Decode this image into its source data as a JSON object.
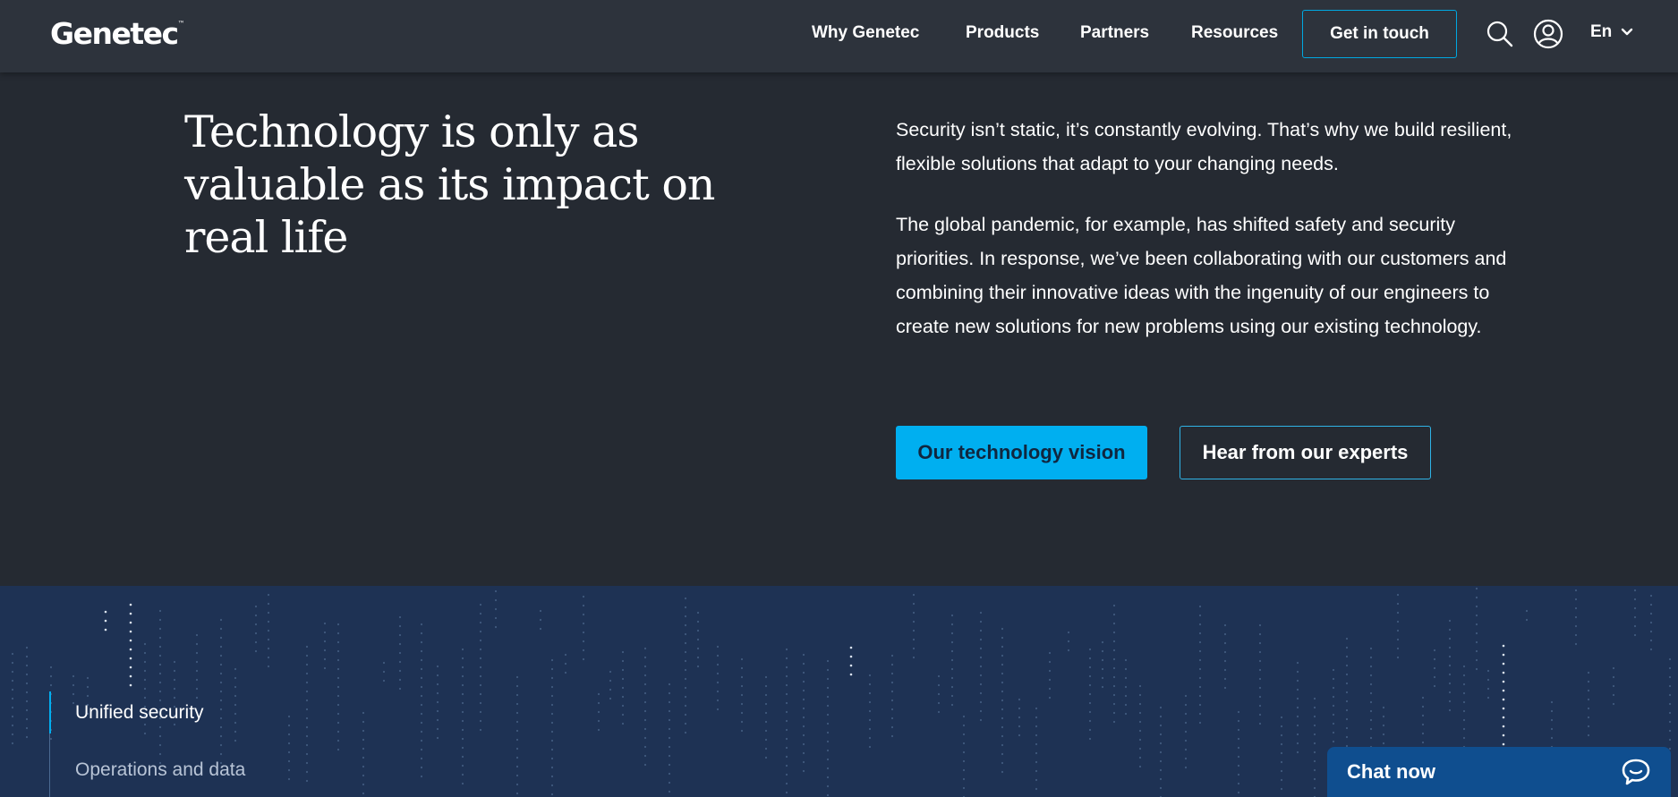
{
  "header": {
    "logo": "Genetec",
    "logo_tm": "™",
    "nav": [
      "Why Genetec",
      "Products",
      "Partners",
      "Resources"
    ],
    "cta": "Get in touch",
    "search_icon": "search-icon",
    "account_icon": "user-icon",
    "language": "En"
  },
  "hero": {
    "title": "Technology is only as valuable as its impact on real life",
    "paragraph_1": "Security isn’t static, it’s constantly evolving. That’s why we build resilient, flexible solutions that adapt to your changing needs.",
    "paragraph_2": "The global pandemic, for example, has shifted safety and security priorities. In response, we’ve been collaborating with our customers and combining their innovative ideas with the ingenuity of our engineers to create new solutions for new problems using our existing technology.",
    "primary_button": "Our technology vision",
    "secondary_button": "Hear from our experts"
  },
  "side_nav": {
    "items": [
      {
        "label": "Unified security",
        "active": true
      },
      {
        "label": "Operations and data",
        "active": false
      }
    ]
  },
  "chat": {
    "label": "Chat now",
    "icon": "chat-bubble-icon"
  },
  "colors": {
    "page_bg": "#252a32",
    "header_bg": "#2d333c",
    "band_bg": "#1e3254",
    "accent": "#00aff0",
    "chat_bg": "#0f4e8f"
  }
}
